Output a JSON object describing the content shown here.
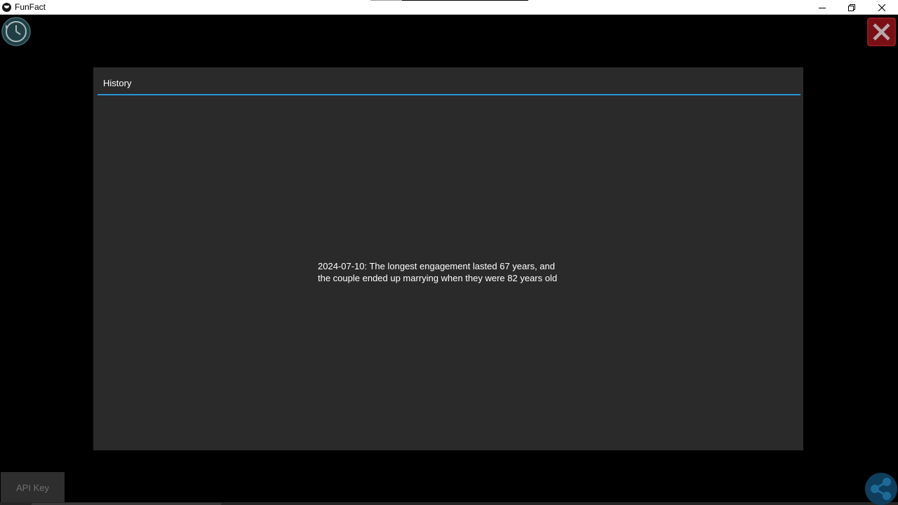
{
  "window": {
    "title": "FunFact"
  },
  "colors": {
    "background": "#000000",
    "dialog": "#2a2a2a",
    "accent": "#2a93d5",
    "close_button": "#7a1016",
    "share_button": "#0e3e5c"
  },
  "icons": {
    "app": "funfact-app-icon",
    "history": "clock-history-icon",
    "close": "close-x-icon",
    "share": "share-icon",
    "minimize": "minimize-icon",
    "restore": "restore-icon",
    "window_close": "window-close-icon"
  },
  "dialog": {
    "title": "History",
    "entries": [
      "2024-07-10: The longest engagement lasted 67 years, and\nthe couple ended up marrying when they were 82 years old"
    ]
  },
  "footer": {
    "api_key_label": "API Key"
  }
}
